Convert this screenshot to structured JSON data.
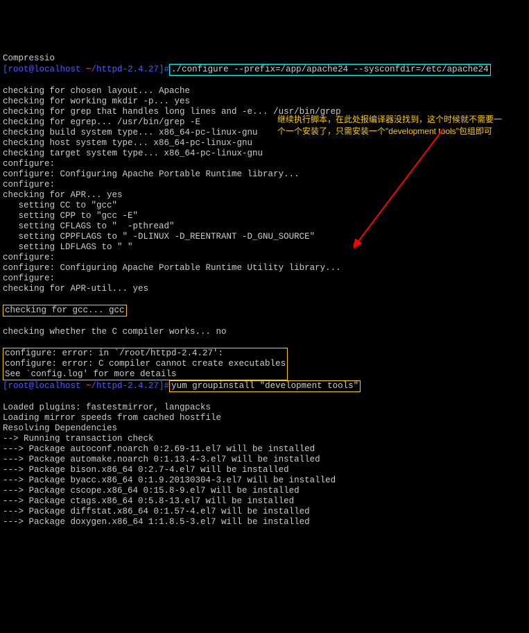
{
  "prompt1": {
    "user": "[root@localhost ",
    "tilde": "~",
    "path": "/httpd-2.4.27]",
    "hash": "#",
    "cmd": "./configure --prefix=/app/apache24 --sysconfdir=/etc/apache24"
  },
  "out1": [
    "checking for chosen layout... Apache",
    "checking for working mkdir -p... yes",
    "checking for grep that handles long lines and -e... /usr/bin/grep",
    "checking for egrep... /usr/bin/grep -E",
    "checking build system type... x86_64-pc-linux-gnu",
    "checking host system type... x86_64-pc-linux-gnu",
    "checking target system type... x86_64-pc-linux-gnu",
    "configure:",
    "configure: Configuring Apache Portable Runtime library...",
    "configure:",
    "checking for APR... yes",
    "   setting CC to \"gcc\"",
    "   setting CPP to \"gcc -E\"",
    "   setting CFLAGS to \"  -pthread\"",
    "   setting CPPFLAGS to \" -DLINUX -D_REENTRANT -D_GNU_SOURCE\"",
    "   setting LDFLAGS to \" \"",
    "configure:",
    "configure: Configuring Apache Portable Runtime Utility library...",
    "configure:",
    "checking for APR-util... yes"
  ],
  "gcc_line": "checking for gcc... gcc",
  "out2": "checking whether the C compiler works... no",
  "err_block": [
    "configure: error: in `/root/httpd-2.4.27':",
    "configure: error: C compiler cannot create executables",
    "See `config.log' for more details"
  ],
  "prompt2": {
    "user": "[root@localhost ",
    "tilde": "~",
    "path": "/httpd-2.4.27]",
    "hash": "#",
    "cmd": "yum groupinstall \"development tools\""
  },
  "out3": [
    "Loaded plugins: fastestmirror, langpacks",
    "Loading mirror speeds from cached hostfile",
    "Resolving Dependencies",
    "--> Running transaction check",
    "---> Package autoconf.noarch 0:2.69-11.el7 will be installed",
    "---> Package automake.noarch 0:1.13.4-3.el7 will be installed",
    "---> Package bison.x86_64 0:2.7-4.el7 will be installed",
    "---> Package byacc.x86_64 0:1.9.20130304-3.el7 will be installed",
    "---> Package cscope.x86_64 0:15.8-9.el7 will be installed",
    "---> Package ctags.x86_64 0:5.8-13.el7 will be installed",
    "---> Package diffstat.x86_64 0:1.57-4.el7 will be installed",
    "---> Package doxygen.x86_64 1:1.8.5-3.el7 will be installed"
  ],
  "annotation": "继续执行脚本，在此处报编译器没找到，这个时候就不需要一个一个安装了，只需安装一个\"development tools\"包组即可",
  "top_cut": "Compressio"
}
